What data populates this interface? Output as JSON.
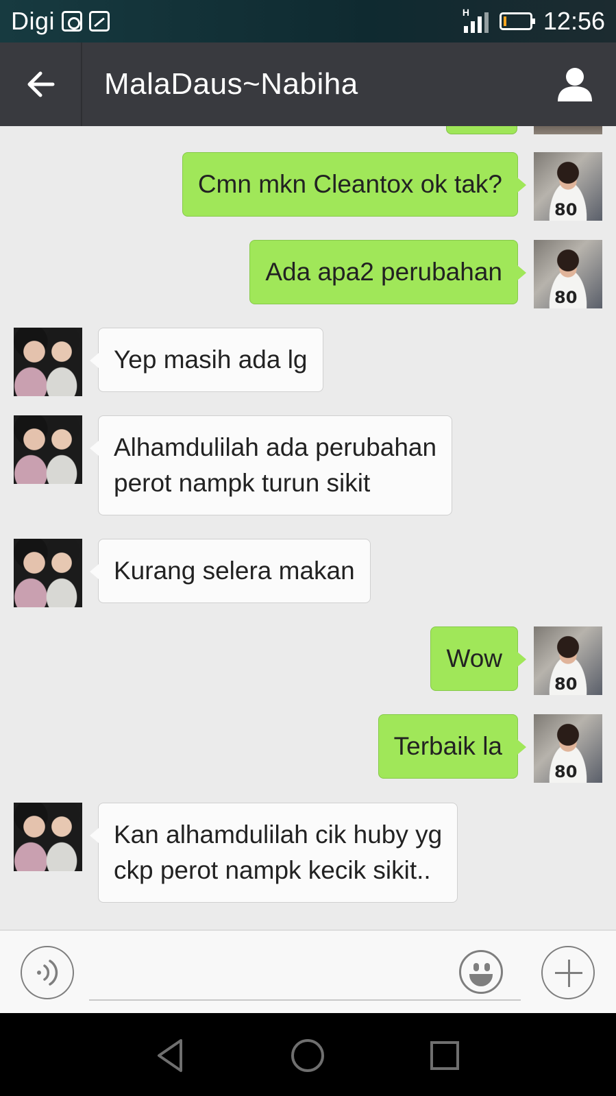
{
  "status_bar": {
    "carrier": "Digi",
    "time": "12:56",
    "network_type": "H",
    "battery_level": 0.1,
    "icons": [
      "instagram-icon",
      "gallery-icon",
      "signal-icon",
      "battery-icon"
    ]
  },
  "header": {
    "title": "MalaDaus~Nabiha",
    "back_icon": "arrow-left-icon",
    "profile_icon": "person-icon"
  },
  "messages": [
    {
      "direction": "out",
      "lines": [
        "Cmn mkn Cleantox ok tak?"
      ]
    },
    {
      "direction": "out",
      "lines": [
        "Ada apa2 perubahan"
      ]
    },
    {
      "direction": "in",
      "lines": [
        "Yep masih ada lg"
      ]
    },
    {
      "direction": "in",
      "lines": [
        "Alhamdulilah ada perubahan",
        "perot nampk turun sikit"
      ]
    },
    {
      "direction": "in",
      "lines": [
        "Kurang selera makan"
      ]
    },
    {
      "direction": "out",
      "lines": [
        "Wow"
      ]
    },
    {
      "direction": "out",
      "lines": [
        "Terbaik la"
      ]
    },
    {
      "direction": "in",
      "lines": [
        "Kan alhamdulilah cik huby yg",
        "ckp perot nampk kecik sikit.."
      ]
    }
  ],
  "my_avatar_text": "80",
  "input_bar": {
    "placeholder": "",
    "value": "",
    "voice_icon": "voice-icon",
    "emoji_icon": "emoji-icon",
    "plus_icon": "plus-icon"
  },
  "nav_bar": {
    "icons": [
      "back-triangle-icon",
      "home-circle-icon",
      "recents-square-icon"
    ]
  },
  "colors": {
    "status_bar": "#173a40",
    "title_bar": "#393a3f",
    "chat_background": "#ebebeb",
    "outgoing_bubble": "#a0e759",
    "incoming_bubble": "#fbfbfb",
    "nav_bar": "#000000"
  }
}
